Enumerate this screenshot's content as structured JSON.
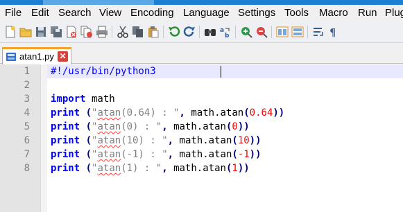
{
  "menu": [
    "File",
    "Edit",
    "Search",
    "View",
    "Encoding",
    "Language",
    "Settings",
    "Tools",
    "Macro",
    "Run",
    "Plugins"
  ],
  "tab": {
    "label": "atan1.py",
    "close_label": "✕"
  },
  "line_numbers": [
    "1",
    "2",
    "3",
    "4",
    "5",
    "6",
    "7",
    "8"
  ],
  "code": {
    "shebang": "#!/usr/bin/python3",
    "import_kw": "import",
    "import_mod": " math",
    "print_kw": "print",
    "math_call": "math.atan",
    "label_prefix": "atan",
    "lines": [
      {
        "arg_label": "(0.64) : ",
        "arg_num": "0.64"
      },
      {
        "arg_label": "(0) : ",
        "arg_num": "0"
      },
      {
        "arg_label": "(10) : ",
        "arg_num": "10"
      },
      {
        "arg_label": "(-1) : ",
        "arg_num": "-1"
      },
      {
        "arg_label": "(1) : ",
        "arg_num": "1"
      }
    ]
  },
  "colors": {
    "keyword": "#0000ff",
    "string": "#808080",
    "number": "#ff0000",
    "operator": "#000080",
    "tab_accent": "#f3a32b"
  },
  "toolbar_icons": [
    "new-icon",
    "open-icon",
    "save-icon",
    "save-all-icon",
    "close-icon",
    "close-all-icon",
    "print-icon",
    "cut-icon",
    "copy-icon",
    "paste-icon",
    "undo-icon",
    "redo-icon",
    "find-icon",
    "replace-icon",
    "zoom-in-icon",
    "zoom-out-icon",
    "sync-v-icon",
    "sync-h-icon",
    "wrap-icon",
    "show-all-icon"
  ]
}
